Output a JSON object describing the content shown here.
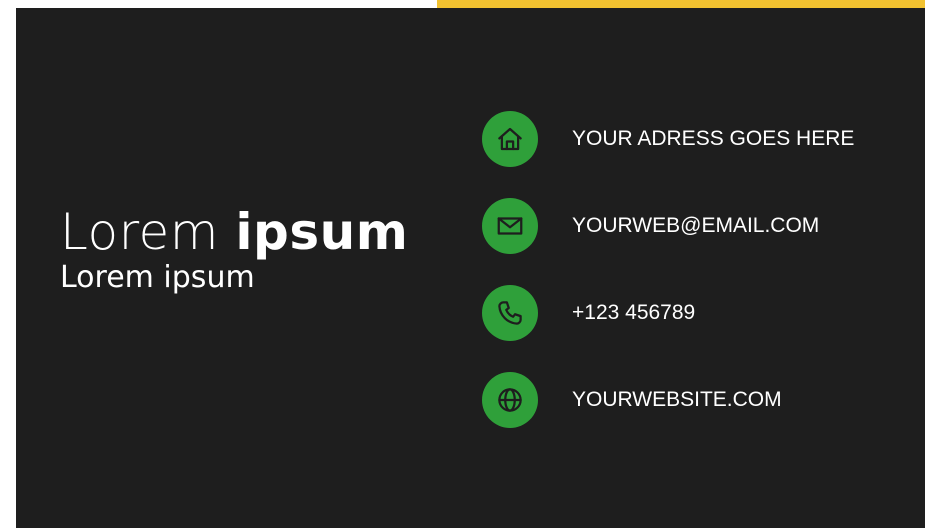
{
  "colors": {
    "accent": "#f2c230",
    "background": "#1e1e1e",
    "icon_fill": "#2fa03a",
    "text": "#ffffff"
  },
  "header": {
    "name_light": "Lorem",
    "name_bold": "ipsum",
    "subtitle": "Lorem ipsum"
  },
  "contacts": [
    {
      "icon": "home-icon",
      "text": "YOUR ADRESS GOES HERE"
    },
    {
      "icon": "mail-icon",
      "text": "YOURWEB@EMAIL.COM"
    },
    {
      "icon": "phone-icon",
      "text": "+123 456789"
    },
    {
      "icon": "globe-icon",
      "text": "YOURWEBSITE.COM"
    }
  ]
}
